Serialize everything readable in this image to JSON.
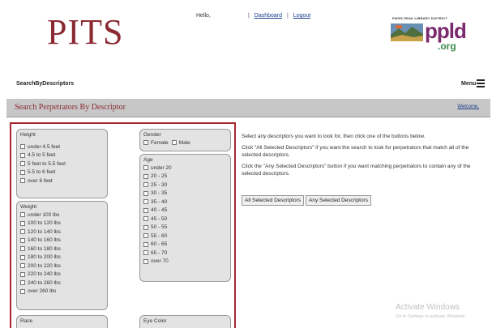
{
  "header": {
    "logo": "PITS",
    "hello": "Hello,",
    "dashboard_link": "Dashboard",
    "logout_link": "Logout",
    "sep": "|"
  },
  "ppld": {
    "tagline": "PIKES PEAK LIBRARY DISTRICT",
    "name": "ppld",
    "domain": ".org"
  },
  "nav": {
    "breadcrumb": "SearchByDescriptors",
    "menu_label": "Menu"
  },
  "page": {
    "title": "Search Perpetrators By Descriptor",
    "welcome": "Welcome,"
  },
  "form": {
    "height": {
      "label": "Height",
      "options": [
        "under 4.5 feet",
        "4.5 to 5 feet",
        "5 feet to 5.5 feet",
        "5.5 to 6 feet",
        "over 6 feet"
      ]
    },
    "weight": {
      "label": "Weight",
      "options": [
        "under 100 lbs",
        "100 to 120 lbs",
        "120 to 140 lbs",
        "140 to 160 lbs",
        "160 to 180 lbs",
        "180 to 200 lbs",
        "200 to 220 lbs",
        "220 to 240 lbs",
        "240 to 260 lbs",
        "over 260 lbs"
      ]
    },
    "gender": {
      "label": "Gender",
      "options": [
        "Female",
        "Male"
      ]
    },
    "age": {
      "label": "Age",
      "options": [
        "under 20",
        "20 - 25",
        "25 - 30",
        "30 - 35",
        "35 - 40",
        "40 - 45",
        "45 - 50",
        "50 - 55",
        "55 - 60",
        "60 - 65",
        "65 - 70",
        "over 70"
      ]
    },
    "race": {
      "label": "Race"
    },
    "eye_color": {
      "label": "Eye Color"
    }
  },
  "instructions": {
    "p1": "Select any descriptors you want to look for, then click one of the buttons below.",
    "p2": "Click \"All Selected Descriptors\" if you want the search to look for perpetrators that match all of the selected descriptors.",
    "p3": "Click the \"Any Selected Descriptors\" button if you want matching perpetrators to contain any of the selected descriptors."
  },
  "buttons": {
    "all": "All Selected Descriptors",
    "any": "Any Selected Descriptors"
  },
  "watermark": {
    "line1": "Activate Windows",
    "line2": "Go to Settings to activate Windows."
  }
}
